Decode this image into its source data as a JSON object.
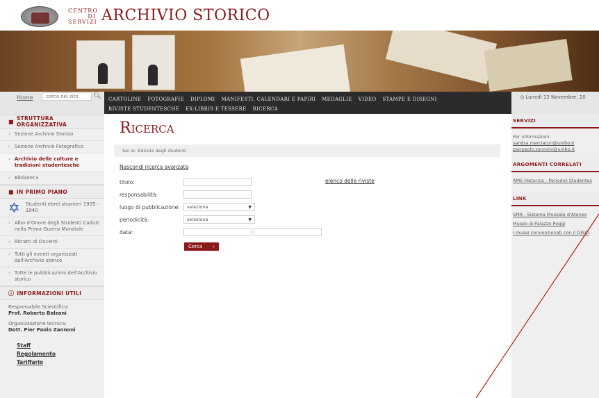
{
  "header": {
    "centro_line1": "CENTRO",
    "centro_line2": "DI SERVIZI",
    "title": "ARCHIVIO STORICO"
  },
  "leftbar": {
    "home_label": "Home",
    "search_placeholder": "cerca nel sito",
    "struttura_head": "STRUTTURA ORGANIZZATIVA",
    "struttura_items": [
      "Sezione Archivio Storico",
      "Sezione Archivio Fotografico",
      "Archivio delle culture e tradizioni studentesche",
      "Biblioteca"
    ],
    "primo_piano_head": "IN PRIMO PIANO",
    "primo_piano_items": [
      "Studenti ebrei stranieri 1935 - 1940",
      "Albo d'Onore degli Studenti Caduti nella Prima Guerra Mondiale",
      "Ritratti di Docenti",
      "Tutti gli eventi organizzati dall'Archivio storico",
      "Tutte le pubblicazioni dell'Archivio storico"
    ],
    "info_head": "INFORMAZIONI UTILI",
    "info_resp_label": "Responsabile Scientifico:",
    "info_resp_name": "Prof. Roberto Balzani",
    "info_org_label": "Organizzazione tecnica:",
    "info_org_name": "Dott. Pier Paolo Zannoni",
    "links": [
      "Staff",
      "Regolamento",
      "Tariffario"
    ]
  },
  "topnav": {
    "items": [
      "Cartoline",
      "Fotografie",
      "Diplomi",
      "Manifesti, Calendari e Papiri",
      "Medaglie",
      "Video",
      "Stampe e Disegni",
      "Riviste studentesche",
      "Ex-libris e Tessere",
      "Ricerca"
    ]
  },
  "main": {
    "title": "Ricerca",
    "breadcrumb": "Sei in: Edicola degli studenti",
    "adv_link": "Nascondi ricerca avanzata",
    "labels": {
      "titolo": "titolo:",
      "responsabilita": "responsabilità:",
      "luogo": "luogo di pubblicazione:",
      "periodicita": "periodicità:",
      "data": "data:"
    },
    "select_value": "seleziona",
    "riviste_link": "elenco delle riviste",
    "cerca_label": "Cerca"
  },
  "rightbar": {
    "date": "Lunedì 12 Novembre, 20",
    "servizi_head": "SERVIZI",
    "servizi_text": "Per informazioni:",
    "servizi_emails": [
      "sandra.marciatori@unibo.it",
      "pierpaolo.zannoni@unibo.it"
    ],
    "argomenti_head": "ARGOMENTI CORRELATI",
    "argomenti_links": [
      "AMS Historica - Periodici Studentes"
    ],
    "link_head": "LINK",
    "link_items": [
      "SMA - Sistema Museale d'Ateneo",
      "Museo di Palazzo Poggi",
      "I musei convenzionati con il DISCI"
    ]
  }
}
